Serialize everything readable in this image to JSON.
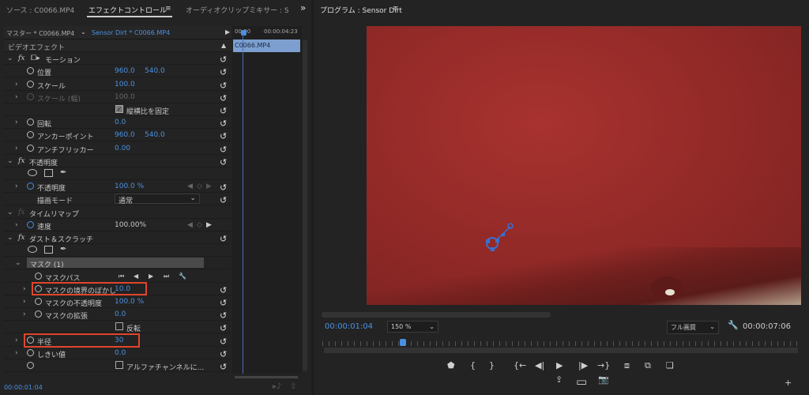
{
  "tabs": {
    "source": "ソース : C0066.MP4",
    "effect_controls": "エフェクトコントロール",
    "audio_mixer": "オーディオクリップミキサー : Sen",
    "menu": "≡",
    "more": "»"
  },
  "subbar": {
    "master": "マスター * C0066.MP4",
    "clip": "Sensor Dirt * C0066.MP4",
    "tl_start": "00:00",
    "tl_end": "00:00:04:23",
    "clip_name": "C0066.MP4"
  },
  "rows": [
    {
      "label": "ビデオエフェクト",
      "kind": "section"
    },
    {
      "label": "モーション",
      "kind": "fx",
      "chev": "v",
      "icon": "motion"
    },
    {
      "label": "位置",
      "sw": true,
      "v1": "960.0",
      "v2": "540.0"
    },
    {
      "label": "スケール",
      "sw": true,
      "chev": ">",
      "v1": "100.0"
    },
    {
      "label": "スケール (幅)",
      "sw": true,
      "chev": ">",
      "v1": "100.0",
      "disabled": true
    },
    {
      "check": "縦横比を固定",
      "checked": true
    },
    {
      "label": "回転",
      "sw": true,
      "chev": ">",
      "v1": "0.0"
    },
    {
      "label": "アンカーポイント",
      "sw": true,
      "v1": "960.0",
      "v2": "540.0"
    },
    {
      "label": "アンチフリッカー",
      "sw": true,
      "chev": ">",
      "v1": "0.00"
    },
    {
      "label": "不透明度",
      "kind": "fx",
      "chev": "v"
    },
    {
      "kind": "shapes"
    },
    {
      "label": "不透明度",
      "sw": true,
      "swblue": true,
      "chev": ">",
      "v1": "100.0 %",
      "kf": true
    },
    {
      "label": "描画モード",
      "select": "通常"
    },
    {
      "label": "タイムリマップ",
      "kind": "fx",
      "chev": "v",
      "fxdim": true,
      "noreset": true
    },
    {
      "label": "速度",
      "sw": true,
      "swblue": true,
      "chev": ">",
      "v1": "100.00%",
      "plain": true,
      "kf": true,
      "noreset": true
    },
    {
      "label": "ダスト＆スクラッチ",
      "kind": "fx",
      "chev": "v"
    },
    {
      "kind": "shapes"
    },
    {
      "label": "マスク (1)",
      "kind": "mask",
      "chev": "v"
    },
    {
      "label": "マスクパス",
      "sw": true,
      "sub": true,
      "maskpath": true,
      "noreset": true
    },
    {
      "label": "マスクの境界のぼかし",
      "sw": true,
      "sub": true,
      "chev": ">",
      "v1": "10.0"
    },
    {
      "label": "マスクの不透明度",
      "sw": true,
      "sub": true,
      "chev": ">",
      "v1": "100.0 %"
    },
    {
      "label": "マスクの拡張",
      "sw": true,
      "sub": true,
      "chev": ">",
      "v1": "0.0"
    },
    {
      "check": "反転",
      "checked": false
    },
    {
      "label": "半径",
      "sw": true,
      "chev": ">",
      "v1": "30"
    },
    {
      "label": "しきい値",
      "sw": true,
      "chev": ">",
      "v1": "0.0"
    },
    {
      "check": "アルファチャンネルに...",
      "checked": false,
      "sw": true
    }
  ],
  "left_timecode": "00:00:01:04",
  "program": {
    "title": "プログラム : Sensor Dirt",
    "menu": "≡",
    "timecode": "00:00:01:04",
    "zoom": "150 %",
    "quality": "フル画質",
    "duration": "00:00:07:06",
    "playhead_fraction": 0.16
  },
  "colors": {
    "accent": "#4a90e2",
    "highlight": "#e0452b"
  }
}
